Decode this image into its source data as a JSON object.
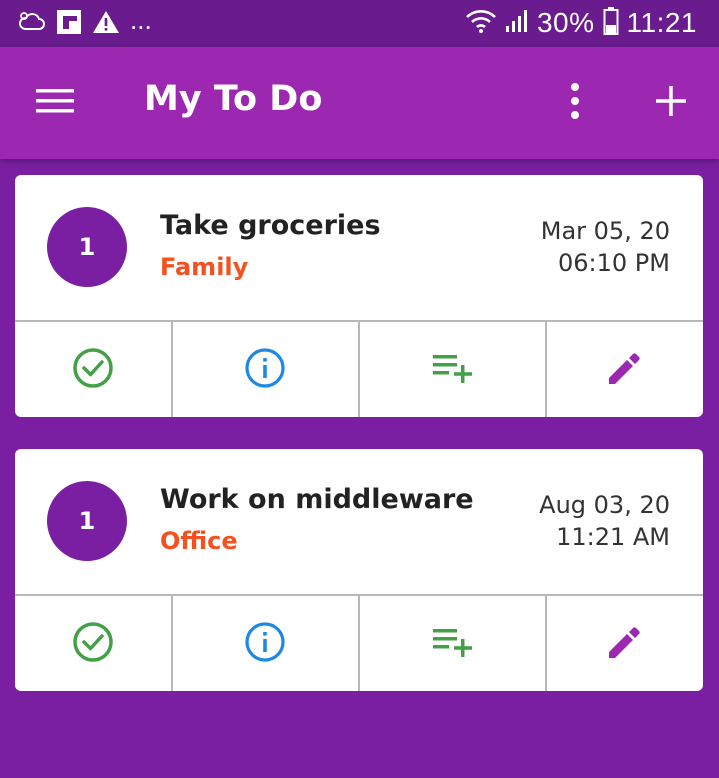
{
  "status_bar": {
    "overflow": "...",
    "battery": "30%",
    "time": "11:21",
    "icons": [
      "cloud-icon",
      "flipboard-icon",
      "warning-icon",
      "wifi-icon",
      "signal-icon",
      "battery-icon"
    ]
  },
  "app_bar": {
    "title": "My To Do",
    "icons": [
      "menu-icon",
      "more-vert-icon",
      "add-icon"
    ]
  },
  "colors": {
    "status_bar": "#6a1b8e",
    "app_bar": "#9c27b0",
    "background": "#7b1fa2",
    "avatar": "#7b1fa2",
    "category": "#f4511e",
    "done": "#43a047",
    "info": "#1e88e5",
    "add_subtask": "#43a047",
    "edit": "#9c27b0"
  },
  "tasks": [
    {
      "priority": "1",
      "title": "Take groceries",
      "category": "Family",
      "date": "Mar 05, 20",
      "time": "06:10 PM",
      "actions": [
        "check-circle-icon",
        "info-icon",
        "playlist-add-icon",
        "edit-pencil-icon"
      ]
    },
    {
      "priority": "1",
      "title": "Work on middleware",
      "category": "Office",
      "date": "Aug 03, 20",
      "time": "11:21 AM",
      "actions": [
        "check-circle-icon",
        "info-icon",
        "playlist-add-icon",
        "edit-pencil-icon"
      ]
    }
  ]
}
